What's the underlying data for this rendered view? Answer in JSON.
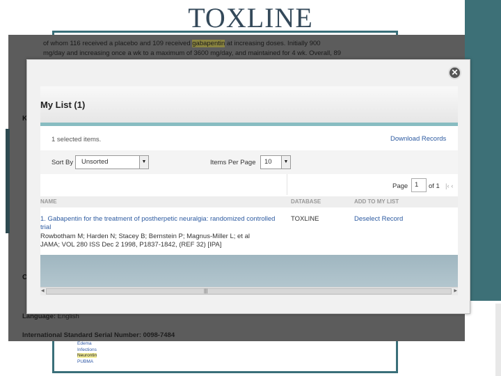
{
  "slide": {
    "title": "TOXLINE"
  },
  "background_page": {
    "abstract_line1_a": "of whom 116 received a placebo and 109 received ",
    "abstract_line1_hl": "gabapentin",
    "abstract_line1_b": " at increasing doses. Initially 900",
    "abstract_line2": "mg/day and increasing once a wk to a maximum of 3600 mg/day, and maintained for 4 wk. Overall, 89",
    "letters": [
      "K",
      "C"
    ],
    "language_label": "Language:",
    "language_value": "English",
    "issn": "International Standard Serial Number: 0098-7484",
    "mesh_items": [
      "Edema",
      "Infections"
    ],
    "mesh_highlight": "Neurontin",
    "mesh_last": "PUBMA"
  },
  "modal": {
    "close_glyph": "✕",
    "title": "My List (1)",
    "selected_text": "1 selected items.",
    "download_label": "Download Records",
    "sort_label": "Sort By",
    "sort_value": "Unsorted",
    "items_per_page_label": "Items Per Page",
    "items_per_page_value": "10",
    "page_label": "Page",
    "page_value": "1",
    "of_label": "of 1",
    "page_nav": "|‹ ‹",
    "dropdown_arrow": "▼",
    "columns": [
      "NAME",
      "DATABASE",
      "ADD TO MY LIST"
    ],
    "record": {
      "title": "1. Gabapentin for the treatment of postherpetic neuralgia: randomized controlled trial",
      "authors": "Rowbotham M; Harden N; Stacey B; Bernstein P; Magnus-Miller L; et al",
      "source": "JAMA; VOL 280 ISS Dec 2 1998, P1837-1842, (REF 32) [IPA]",
      "database": "TOXLINE",
      "action": "Deselect Record"
    },
    "scroll_grip": "|||",
    "scroll_left": "◀",
    "scroll_right": "▶"
  },
  "colors": {
    "accent_teal": "#3d7077",
    "link_blue": "#2c5aa0",
    "highlight": "#f4ef9a"
  }
}
